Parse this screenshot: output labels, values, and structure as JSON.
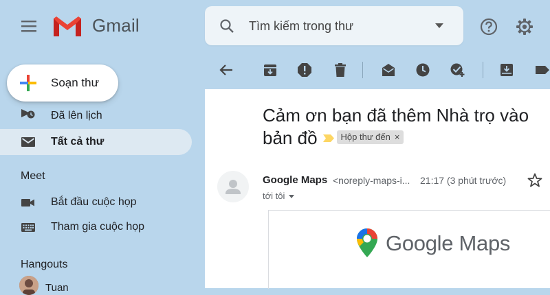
{
  "app": {
    "name": "Gmail"
  },
  "search": {
    "placeholder": "Tìm kiếm trong thư"
  },
  "compose": {
    "label": "Soạn thư"
  },
  "sidebar": {
    "items": [
      {
        "label": "Đã lên lịch",
        "icon": "scheduled-send-icon"
      },
      {
        "label": "Tất cả thư",
        "icon": "all-mail-icon",
        "active": true
      }
    ],
    "meet": {
      "title": "Meet",
      "items": [
        {
          "label": "Bắt đầu cuộc họp",
          "icon": "video-camera-icon"
        },
        {
          "label": "Tham gia cuộc họp",
          "icon": "keyboard-icon"
        }
      ]
    },
    "hangouts": {
      "title": "Hangouts",
      "contact": "Tuan"
    }
  },
  "toolbar": {
    "icons": [
      "back-arrow-icon",
      "archive-icon",
      "report-spam-icon",
      "delete-icon",
      "mark-unread-icon",
      "snooze-icon",
      "add-task-icon",
      "move-to-icon",
      "label-icon"
    ]
  },
  "email": {
    "subject": "Cảm ơn bạn đã thêm Nhà trọ vào bản đồ",
    "label_badge": "Hộp thư đến",
    "label_badge_close": "×",
    "sender_name": "Google Maps",
    "sender_email": "<noreply-maps-i...",
    "time": "21:17 (3 phút trước)",
    "recipient": "tới tôi",
    "body_logo_text": "Google Maps"
  },
  "colors": {
    "background": "#b9d6ec",
    "gmail_red": "#ea4335",
    "important_marker": "#fdd663"
  }
}
